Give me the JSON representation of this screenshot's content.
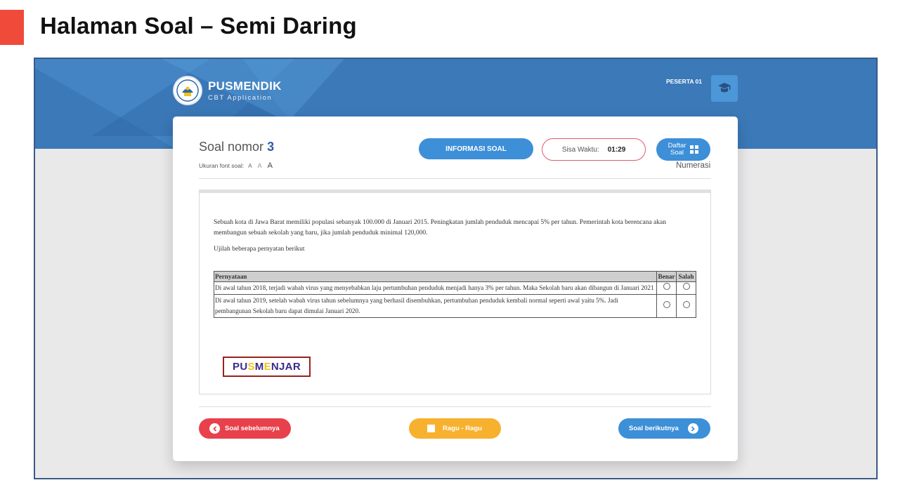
{
  "slide": {
    "title": "Halaman Soal – Semi Daring"
  },
  "app": {
    "name": "PUSMENDIK",
    "subtitle": "CBT Application",
    "user": "PESERTA 01"
  },
  "soal": {
    "label": "Soal nomor",
    "number": "3",
    "font_label": "Ukuran font soal:",
    "font_sizes": [
      "A",
      "A",
      "A"
    ],
    "info_button": "INFORMASI SOAL",
    "timer_label": "Sisa Waktu:",
    "timer_value": "01:29",
    "daftar_line1": "Daftar",
    "daftar_line2": "Soal",
    "category": "Numerasi"
  },
  "question": {
    "paragraph": "Sebuah kota di Jawa Barat memiliki populasi sebanyak 100.000 di Januari 2015. Peningkatan jumlah penduduk mencapai 5% per tahun. Pemerintah kota berencana akan membangun sebuah sekolah yang baru, jika jumlah penduduk minimal 120,000.",
    "instruction": "Ujilah beberapa pernyatan berikut",
    "table": {
      "headers": [
        "Pernyataan",
        "Benar",
        "Salah"
      ],
      "rows": [
        "Di awal tahun 2018, terjadi wabah virus yang menyebabkan laju pertumbuhan penduduk menjadi hanya 3% per tahun. Maka Sekolah baru akan dibangun di Januari 2021",
        "Di awal tahun 2019, setelah wabah virus tahun sebelumnya yang berhasil disembuhkan, pertumbuhan penduduk kembali normal seperti awal yaitu 5%. Jadi pembangunan Sekolah baru dapat dimulai Januari 2020."
      ]
    },
    "logo": {
      "parts": [
        "PU",
        "S",
        "M",
        "E",
        "NJAR"
      ],
      "colors": [
        "#3a2a8a",
        "#f2c21b",
        "#3a2a8a",
        "#f2c21b",
        "#3a2a8a"
      ]
    }
  },
  "nav": {
    "prev": "Soal sebelumnya",
    "ragu": "Ragu - Ragu",
    "next": "Soal berikutnya"
  },
  "colors": {
    "accent_red": "#ef4a3a",
    "banner_blue": "#3b79b8",
    "button_blue": "#3d8fd8",
    "button_red": "#e8414b",
    "button_yellow": "#f7b12e"
  },
  "icons": [
    "user-icon",
    "grid-icon",
    "chevron-left-icon",
    "chevron-right-icon",
    "checkbox-icon",
    "seal-logo-icon"
  ]
}
